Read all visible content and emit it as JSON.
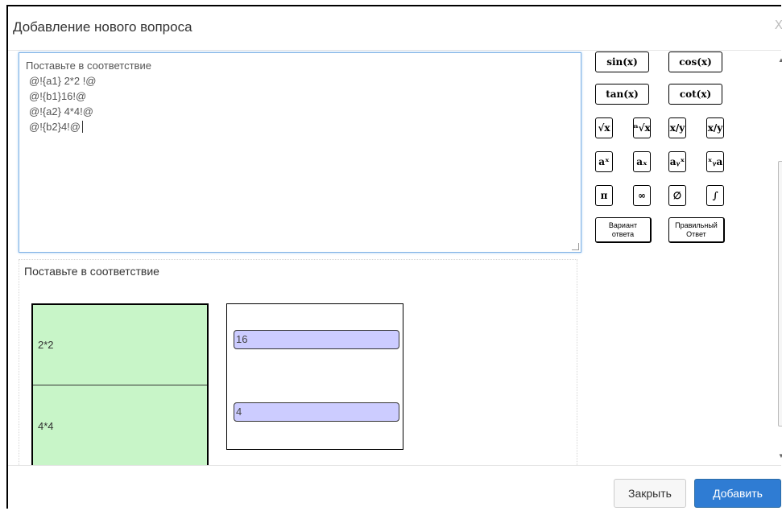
{
  "dialog": {
    "title": "Добавление нового вопроса",
    "close_glyph": "X"
  },
  "editor": {
    "lines": [
      "Поставьте в соответствие",
      "@!{a1} 2*2 !@",
      "@!{b1}16!@",
      "@!{a2} 4*4!@",
      "@!{b2}4!@"
    ]
  },
  "math_buttons": {
    "sin": "sin(x)",
    "cos": "cos(x)",
    "tan": "tan(x)",
    "cot": "cot(x)",
    "sqrt": "√x",
    "nthroot": "ⁿ√x",
    "frac": "x/y",
    "slash": "x/y",
    "power": "aˣ",
    "subscript": "aₓ",
    "subsup": "aᵧˣ",
    "presub": "ˣᵧa",
    "pi": "π",
    "infinity": "∞",
    "emptyset": "∅",
    "integral": "∫",
    "variant_line1": "Вариант",
    "variant_line2": "ответа",
    "correct_line1": "Правильный",
    "correct_line2": "Ответ"
  },
  "preview": {
    "title": "Поставьте в соответствие",
    "left_items": [
      "2*2",
      "4*4"
    ],
    "right_answers": [
      "16",
      "4"
    ]
  },
  "footer": {
    "close_label": "Закрыть",
    "add_label": "Добавить"
  },
  "colors": {
    "left_bg": "#c8f5c8",
    "answer_bg": "#ccccff",
    "primary": "#2f7cd3"
  }
}
